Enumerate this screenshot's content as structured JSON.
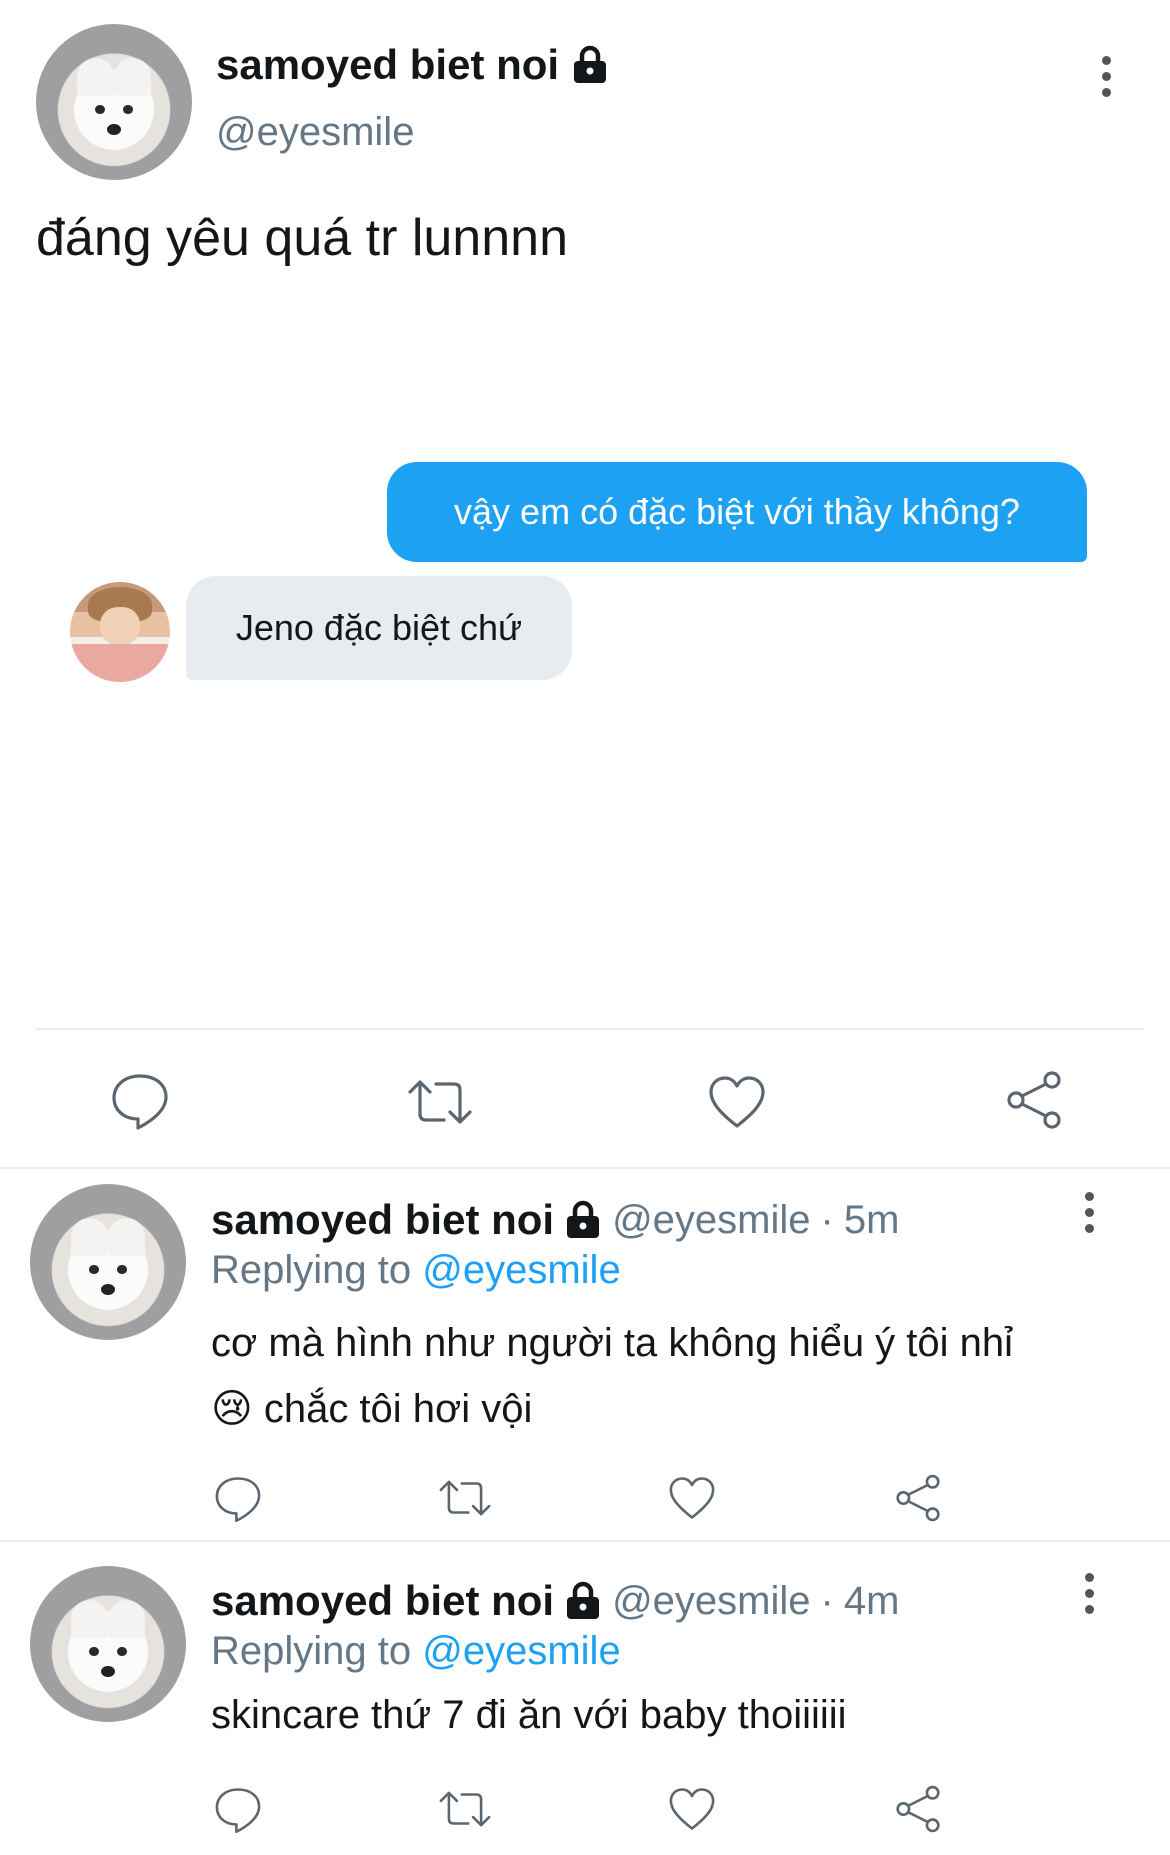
{
  "main_tweet": {
    "display_name": "samoyed biet noi",
    "handle": "@eyesmile",
    "text": "đáng yêu quá tr lunnnn",
    "embedded_chat": {
      "sent_message": "vậy em có đặc biệt với thầy không?",
      "received_message": "Jeno đặc biệt chứ"
    },
    "actions": [
      "reply-icon",
      "retweet-icon",
      "like-icon",
      "share-icon"
    ]
  },
  "replies": [
    {
      "display_name": "samoyed biet noi",
      "handle": "@eyesmile",
      "separator": "·",
      "time": "5m",
      "replying_prefix": "Replying to",
      "replying_to": "@eyesmile",
      "text_line1": "cơ mà hình như người ta không hiểu ý tôi nhỉ",
      "emoji": "😢",
      "text_line2": "chắc tôi hơi vội"
    },
    {
      "display_name": "samoyed biet noi",
      "handle": "@eyesmile",
      "separator": "·",
      "time": "4m",
      "replying_prefix": "Replying to",
      "replying_to": "@eyesmile",
      "text_line1": "skincare thứ 7 đi ăn với baby thoiiiiii"
    }
  ],
  "colors": {
    "accent": "#1da1f2",
    "text": "#14171a",
    "secondary": "#657786",
    "bubble_other": "#e6ecf0",
    "divider": "#e6ecf0"
  }
}
